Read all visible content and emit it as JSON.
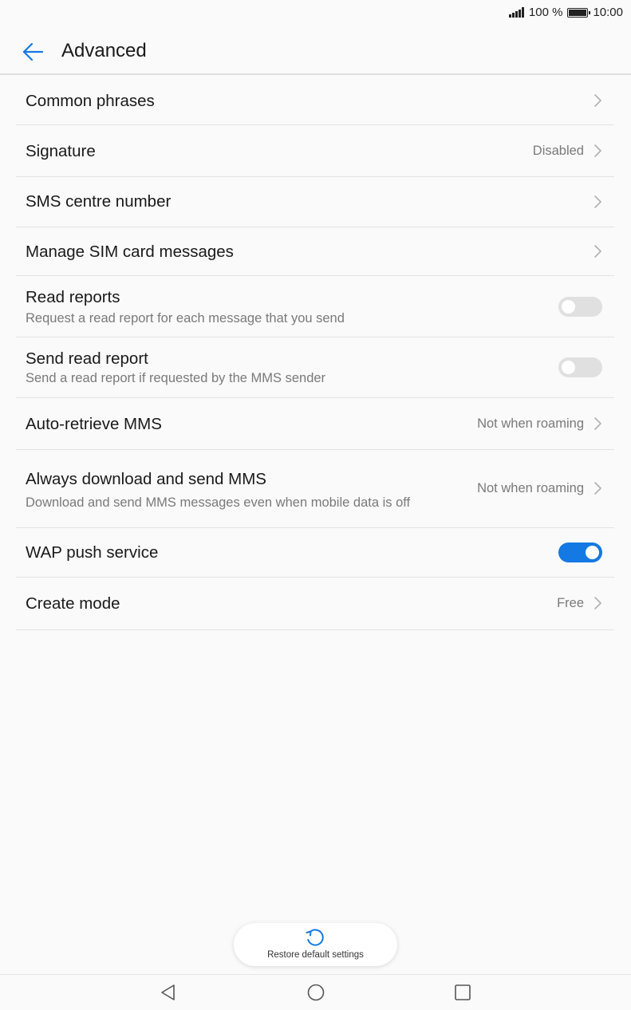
{
  "status": {
    "battery_text": "100 %",
    "time": "10:00",
    "battery_level": 1.0
  },
  "appbar": {
    "title": "Advanced",
    "back_icon": "arrow-left-icon"
  },
  "settings": [
    {
      "label": "Common phrases",
      "sub": "",
      "value": "",
      "control": "chevron"
    },
    {
      "label": "Signature",
      "sub": "",
      "value": "Disabled",
      "control": "chevron"
    },
    {
      "label": "SMS centre number",
      "sub": "",
      "value": "",
      "control": "chevron"
    },
    {
      "label": "Manage SIM card messages",
      "sub": "",
      "value": "",
      "control": "chevron"
    },
    {
      "label": "Read reports",
      "sub": "Request a read report for each message that you send",
      "value": "",
      "control": "toggle",
      "on": false
    },
    {
      "label": "Send read report",
      "sub": "Send a read report if requested by the MMS sender",
      "value": "",
      "control": "toggle",
      "on": false
    },
    {
      "label": "Auto-retrieve MMS",
      "sub": "",
      "value": "Not when roaming",
      "control": "chevron"
    },
    {
      "label": "Always download and send MMS",
      "sub": "Download and send MMS messages even when mobile data is off",
      "value": "Not when roaming",
      "control": "chevron"
    },
    {
      "label": "WAP push service",
      "sub": "",
      "value": "",
      "control": "toggle",
      "on": true
    },
    {
      "label": "Create mode",
      "sub": "",
      "value": "Free",
      "control": "chevron"
    }
  ],
  "restore": {
    "label": "Restore default settings",
    "icon": "restore-icon"
  },
  "navbar": {
    "back_icon": "nav-back-icon",
    "home_icon": "nav-home-icon",
    "recents_icon": "nav-recents-icon"
  },
  "colors": {
    "accent": "#1479e3",
    "toggle_off": "#e0e0e0",
    "secondary_text": "#7a7a7a"
  }
}
